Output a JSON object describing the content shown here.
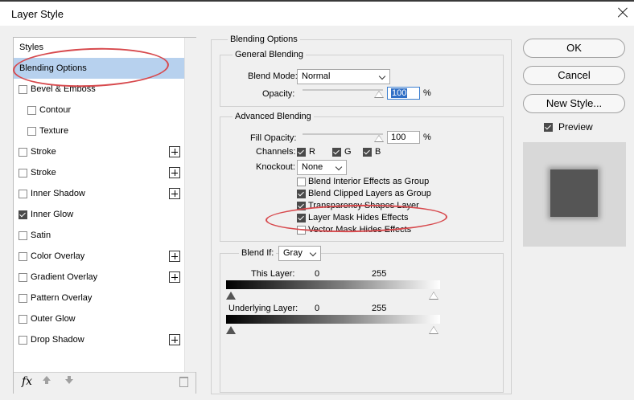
{
  "window": {
    "title": "Layer Style"
  },
  "styles_list": {
    "header": "Styles",
    "items": [
      {
        "label": "Blending Options",
        "checkbox": false,
        "checked": false,
        "selected": true,
        "plus": false
      },
      {
        "label": "Bevel & Emboss",
        "checkbox": true,
        "checked": false,
        "plus": false
      },
      {
        "label": "Contour",
        "checkbox": true,
        "checked": false,
        "plus": false,
        "indent": true
      },
      {
        "label": "Texture",
        "checkbox": true,
        "checked": false,
        "plus": false,
        "indent": true
      },
      {
        "label": "Stroke",
        "checkbox": true,
        "checked": false,
        "plus": true
      },
      {
        "label": "Stroke",
        "checkbox": true,
        "checked": false,
        "plus": true
      },
      {
        "label": "Inner Shadow",
        "checkbox": true,
        "checked": false,
        "plus": true
      },
      {
        "label": "Inner Glow",
        "checkbox": true,
        "checked": true,
        "plus": false
      },
      {
        "label": "Satin",
        "checkbox": true,
        "checked": false,
        "plus": false
      },
      {
        "label": "Color Overlay",
        "checkbox": true,
        "checked": false,
        "plus": true
      },
      {
        "label": "Gradient Overlay",
        "checkbox": true,
        "checked": false,
        "plus": true
      },
      {
        "label": "Pattern Overlay",
        "checkbox": true,
        "checked": false,
        "plus": false
      },
      {
        "label": "Outer Glow",
        "checkbox": true,
        "checked": false,
        "plus": false
      },
      {
        "label": "Drop Shadow",
        "checkbox": true,
        "checked": false,
        "plus": true
      }
    ],
    "toolbar": {
      "fx": "fx"
    }
  },
  "blending": {
    "section_title": "Blending Options",
    "general": {
      "title": "General Blending",
      "blend_mode_label": "Blend Mode:",
      "blend_mode_value": "Normal",
      "opacity_label": "Opacity:",
      "opacity_value": "100",
      "percent": "%"
    },
    "advanced": {
      "title": "Advanced Blending",
      "fill_opacity_label": "Fill Opacity:",
      "fill_opacity_value": "100",
      "percent": "%",
      "channels_label": "Channels:",
      "channels": [
        {
          "label": "R",
          "checked": true
        },
        {
          "label": "G",
          "checked": true
        },
        {
          "label": "B",
          "checked": true
        }
      ],
      "knockout_label": "Knockout:",
      "knockout_value": "None",
      "options": [
        {
          "label": "Blend Interior Effects as Group",
          "checked": false
        },
        {
          "label": "Blend Clipped Layers as Group",
          "checked": true
        },
        {
          "label": "Transparency Shapes Layer",
          "checked": true
        },
        {
          "label": "Layer Mask Hides Effects",
          "checked": true
        },
        {
          "label": "Vector Mask Hides Effects",
          "checked": false
        }
      ]
    },
    "blend_if": {
      "label": "Blend If:",
      "value": "Gray",
      "this_layer_label": "This Layer:",
      "this_layer_low": "0",
      "this_layer_high": "255",
      "underlying_label": "Underlying Layer:",
      "underlying_low": "0",
      "underlying_high": "255"
    }
  },
  "buttons": {
    "ok": "OK",
    "cancel": "Cancel",
    "new_style": "New Style..."
  },
  "preview": {
    "label": "Preview",
    "checked": true
  },
  "colors": {
    "selection": "#b7d1ee",
    "annotation": "#d7494d"
  }
}
